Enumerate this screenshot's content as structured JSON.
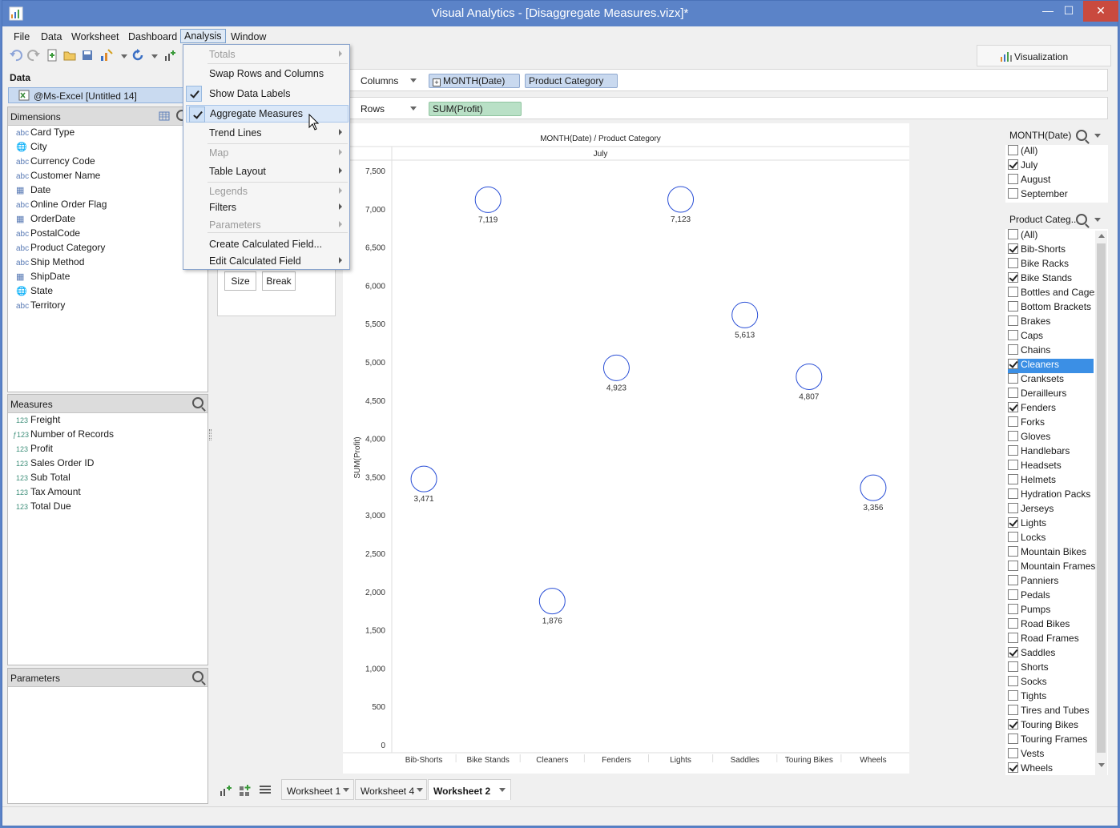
{
  "window": {
    "title": "Visual Analytics - [Disaggregate Measures.vizx]*"
  },
  "menubar": {
    "items": [
      "File",
      "Data",
      "Worksheet",
      "Dashboard",
      "Analysis",
      "Window"
    ]
  },
  "toolbar": {
    "viz_label": "Visualization"
  },
  "data_panel": {
    "title": "Data",
    "source": "@Ms-Excel [Untitled 14]"
  },
  "dimensions": {
    "title": "Dimensions",
    "items": [
      {
        "type": "abc",
        "label": "Card Type"
      },
      {
        "type": "geo",
        "label": "City"
      },
      {
        "type": "abc",
        "label": "Currency Code"
      },
      {
        "type": "abc",
        "label": "Customer Name"
      },
      {
        "type": "date",
        "label": "Date"
      },
      {
        "type": "abc",
        "label": "Online Order Flag"
      },
      {
        "type": "datetime",
        "label": "OrderDate"
      },
      {
        "type": "abc",
        "label": "PostalCode"
      },
      {
        "type": "abc",
        "label": "Product Category"
      },
      {
        "type": "abc",
        "label": "Ship Method"
      },
      {
        "type": "datetime",
        "label": "ShipDate"
      },
      {
        "type": "geo",
        "label": "State"
      },
      {
        "type": "abc",
        "label": "Territory"
      }
    ]
  },
  "measures": {
    "title": "Measures",
    "items": [
      {
        "type": "123",
        "label": "Freight"
      },
      {
        "type": "calc123",
        "label": "Number of Records"
      },
      {
        "type": "123",
        "label": "Profit"
      },
      {
        "type": "123",
        "label": "Sales Order ID"
      },
      {
        "type": "123",
        "label": "Sub Total"
      },
      {
        "type": "123",
        "label": "Tax Amount"
      },
      {
        "type": "123",
        "label": "Total Due"
      }
    ]
  },
  "parameters": {
    "title": "Parameters"
  },
  "shelves": {
    "columns_label": "Columns",
    "rows_label": "Rows",
    "columns_pills": [
      "MONTH(Date)",
      "Product Category"
    ],
    "rows_pills": [
      "SUM(Profit)"
    ]
  },
  "marks_card": {
    "size_label": "Size",
    "break_label": "Break"
  },
  "analysis_menu": {
    "items": [
      {
        "label": "Totals",
        "disabled": true,
        "submenu": true,
        "checked": false
      },
      {
        "label": "Swap Rows and Columns",
        "disabled": false,
        "submenu": false,
        "checked": false
      },
      {
        "label": "Show Data Labels",
        "disabled": false,
        "submenu": false,
        "checked": true
      },
      {
        "label": "Aggregate Measures",
        "disabled": false,
        "submenu": false,
        "checked": true,
        "highlighted": true
      },
      {
        "label": "Trend Lines",
        "disabled": false,
        "submenu": true,
        "checked": false
      },
      {
        "label": "Map",
        "disabled": true,
        "submenu": true,
        "checked": false
      },
      {
        "label": "Table Layout",
        "disabled": false,
        "submenu": true,
        "checked": false
      },
      {
        "label": "Legends",
        "disabled": true,
        "submenu": true,
        "checked": false
      },
      {
        "label": "Filters",
        "disabled": false,
        "submenu": true,
        "checked": false
      },
      {
        "label": "Parameters",
        "disabled": true,
        "submenu": true,
        "checked": false
      },
      {
        "label": "Create Calculated Field...",
        "disabled": false,
        "submenu": false,
        "checked": false
      },
      {
        "label": "Edit Calculated Field",
        "disabled": false,
        "submenu": true,
        "checked": false
      }
    ]
  },
  "chart_data": {
    "type": "scatter",
    "title": "MONTH(Date) / Product Category",
    "subtitle": "July",
    "ylabel": "SUM(Profit)",
    "ylim": [
      0,
      7500
    ],
    "yticks": [
      0,
      500,
      1000,
      1500,
      2000,
      2500,
      3000,
      3500,
      4000,
      4500,
      5000,
      5500,
      6000,
      6500,
      7000,
      7500
    ],
    "categories": [
      "Bib-Shorts",
      "Bike Stands",
      "Cleaners",
      "Fenders",
      "Lights",
      "Saddles",
      "Touring Bikes",
      "Wheels"
    ],
    "values": [
      3471,
      7119,
      1876,
      4923,
      7123,
      5613,
      4807,
      3356
    ],
    "labels": [
      "3,471",
      "7,119",
      "1,876",
      "4,923",
      "7,123",
      "5,613",
      "4,807",
      "3,356"
    ]
  },
  "filter_month": {
    "title": "MONTH(Date)",
    "items": [
      {
        "label": "(All)",
        "checked": false
      },
      {
        "label": "July",
        "checked": true
      },
      {
        "label": "August",
        "checked": false
      },
      {
        "label": "September",
        "checked": false
      }
    ]
  },
  "filter_category": {
    "title": "Product Categ...",
    "items": [
      {
        "label": "(All)",
        "checked": false
      },
      {
        "label": "Bib-Shorts",
        "checked": true
      },
      {
        "label": "Bike Racks",
        "checked": false
      },
      {
        "label": "Bike Stands",
        "checked": true
      },
      {
        "label": "Bottles and Cages",
        "checked": false
      },
      {
        "label": "Bottom Brackets",
        "checked": false
      },
      {
        "label": "Brakes",
        "checked": false
      },
      {
        "label": "Caps",
        "checked": false
      },
      {
        "label": "Chains",
        "checked": false
      },
      {
        "label": "Cleaners",
        "checked": true,
        "selected": true
      },
      {
        "label": "Cranksets",
        "checked": false
      },
      {
        "label": "Derailleurs",
        "checked": false
      },
      {
        "label": "Fenders",
        "checked": true
      },
      {
        "label": "Forks",
        "checked": false
      },
      {
        "label": "Gloves",
        "checked": false
      },
      {
        "label": "Handlebars",
        "checked": false
      },
      {
        "label": "Headsets",
        "checked": false
      },
      {
        "label": "Helmets",
        "checked": false
      },
      {
        "label": "Hydration Packs",
        "checked": false
      },
      {
        "label": "Jerseys",
        "checked": false
      },
      {
        "label": "Lights",
        "checked": true
      },
      {
        "label": "Locks",
        "checked": false
      },
      {
        "label": "Mountain Bikes",
        "checked": false
      },
      {
        "label": "Mountain Frames",
        "checked": false
      },
      {
        "label": "Panniers",
        "checked": false
      },
      {
        "label": "Pedals",
        "checked": false
      },
      {
        "label": "Pumps",
        "checked": false
      },
      {
        "label": "Road Bikes",
        "checked": false
      },
      {
        "label": "Road Frames",
        "checked": false
      },
      {
        "label": "Saddles",
        "checked": true
      },
      {
        "label": "Shorts",
        "checked": false
      },
      {
        "label": "Socks",
        "checked": false
      },
      {
        "label": "Tights",
        "checked": false
      },
      {
        "label": "Tires and Tubes",
        "checked": false
      },
      {
        "label": "Touring Bikes",
        "checked": true
      },
      {
        "label": "Touring Frames",
        "checked": false
      },
      {
        "label": "Vests",
        "checked": false
      },
      {
        "label": "Wheels",
        "checked": true
      }
    ]
  },
  "tabs": {
    "items": [
      "Worksheet 1",
      "Worksheet 4",
      "Worksheet 2"
    ],
    "active": 2
  },
  "colors": {
    "accent": "#5b83c8",
    "mark": "#2a4fd6",
    "selection": "#3b8fe5"
  }
}
